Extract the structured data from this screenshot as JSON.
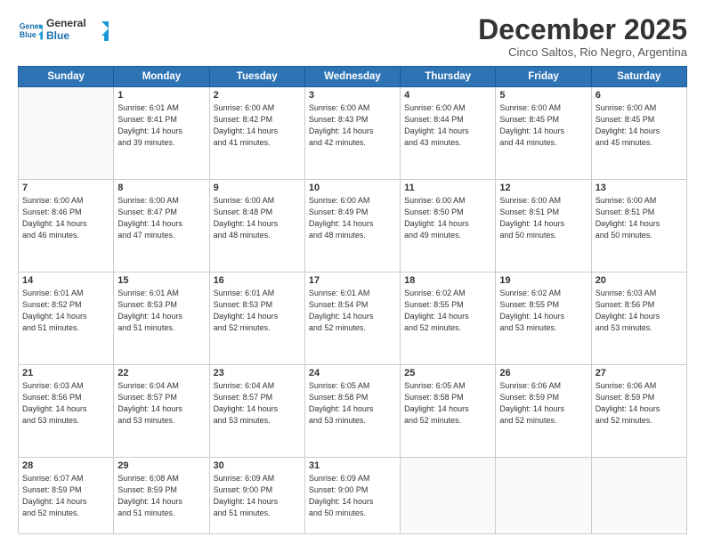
{
  "header": {
    "logo_line1": "General",
    "logo_line2": "Blue",
    "month": "December 2025",
    "location": "Cinco Saltos, Rio Negro, Argentina"
  },
  "weekdays": [
    "Sunday",
    "Monday",
    "Tuesday",
    "Wednesday",
    "Thursday",
    "Friday",
    "Saturday"
  ],
  "weeks": [
    [
      {
        "day": "",
        "info": ""
      },
      {
        "day": "1",
        "info": "Sunrise: 6:01 AM\nSunset: 8:41 PM\nDaylight: 14 hours\nand 39 minutes."
      },
      {
        "day": "2",
        "info": "Sunrise: 6:00 AM\nSunset: 8:42 PM\nDaylight: 14 hours\nand 41 minutes."
      },
      {
        "day": "3",
        "info": "Sunrise: 6:00 AM\nSunset: 8:43 PM\nDaylight: 14 hours\nand 42 minutes."
      },
      {
        "day": "4",
        "info": "Sunrise: 6:00 AM\nSunset: 8:44 PM\nDaylight: 14 hours\nand 43 minutes."
      },
      {
        "day": "5",
        "info": "Sunrise: 6:00 AM\nSunset: 8:45 PM\nDaylight: 14 hours\nand 44 minutes."
      },
      {
        "day": "6",
        "info": "Sunrise: 6:00 AM\nSunset: 8:45 PM\nDaylight: 14 hours\nand 45 minutes."
      }
    ],
    [
      {
        "day": "7",
        "info": "Sunrise: 6:00 AM\nSunset: 8:46 PM\nDaylight: 14 hours\nand 46 minutes."
      },
      {
        "day": "8",
        "info": "Sunrise: 6:00 AM\nSunset: 8:47 PM\nDaylight: 14 hours\nand 47 minutes."
      },
      {
        "day": "9",
        "info": "Sunrise: 6:00 AM\nSunset: 8:48 PM\nDaylight: 14 hours\nand 48 minutes."
      },
      {
        "day": "10",
        "info": "Sunrise: 6:00 AM\nSunset: 8:49 PM\nDaylight: 14 hours\nand 48 minutes."
      },
      {
        "day": "11",
        "info": "Sunrise: 6:00 AM\nSunset: 8:50 PM\nDaylight: 14 hours\nand 49 minutes."
      },
      {
        "day": "12",
        "info": "Sunrise: 6:00 AM\nSunset: 8:51 PM\nDaylight: 14 hours\nand 50 minutes."
      },
      {
        "day": "13",
        "info": "Sunrise: 6:00 AM\nSunset: 8:51 PM\nDaylight: 14 hours\nand 50 minutes."
      }
    ],
    [
      {
        "day": "14",
        "info": "Sunrise: 6:01 AM\nSunset: 8:52 PM\nDaylight: 14 hours\nand 51 minutes."
      },
      {
        "day": "15",
        "info": "Sunrise: 6:01 AM\nSunset: 8:53 PM\nDaylight: 14 hours\nand 51 minutes."
      },
      {
        "day": "16",
        "info": "Sunrise: 6:01 AM\nSunset: 8:53 PM\nDaylight: 14 hours\nand 52 minutes."
      },
      {
        "day": "17",
        "info": "Sunrise: 6:01 AM\nSunset: 8:54 PM\nDaylight: 14 hours\nand 52 minutes."
      },
      {
        "day": "18",
        "info": "Sunrise: 6:02 AM\nSunset: 8:55 PM\nDaylight: 14 hours\nand 52 minutes."
      },
      {
        "day": "19",
        "info": "Sunrise: 6:02 AM\nSunset: 8:55 PM\nDaylight: 14 hours\nand 53 minutes."
      },
      {
        "day": "20",
        "info": "Sunrise: 6:03 AM\nSunset: 8:56 PM\nDaylight: 14 hours\nand 53 minutes."
      }
    ],
    [
      {
        "day": "21",
        "info": "Sunrise: 6:03 AM\nSunset: 8:56 PM\nDaylight: 14 hours\nand 53 minutes."
      },
      {
        "day": "22",
        "info": "Sunrise: 6:04 AM\nSunset: 8:57 PM\nDaylight: 14 hours\nand 53 minutes."
      },
      {
        "day": "23",
        "info": "Sunrise: 6:04 AM\nSunset: 8:57 PM\nDaylight: 14 hours\nand 53 minutes."
      },
      {
        "day": "24",
        "info": "Sunrise: 6:05 AM\nSunset: 8:58 PM\nDaylight: 14 hours\nand 53 minutes."
      },
      {
        "day": "25",
        "info": "Sunrise: 6:05 AM\nSunset: 8:58 PM\nDaylight: 14 hours\nand 52 minutes."
      },
      {
        "day": "26",
        "info": "Sunrise: 6:06 AM\nSunset: 8:59 PM\nDaylight: 14 hours\nand 52 minutes."
      },
      {
        "day": "27",
        "info": "Sunrise: 6:06 AM\nSunset: 8:59 PM\nDaylight: 14 hours\nand 52 minutes."
      }
    ],
    [
      {
        "day": "28",
        "info": "Sunrise: 6:07 AM\nSunset: 8:59 PM\nDaylight: 14 hours\nand 52 minutes."
      },
      {
        "day": "29",
        "info": "Sunrise: 6:08 AM\nSunset: 8:59 PM\nDaylight: 14 hours\nand 51 minutes."
      },
      {
        "day": "30",
        "info": "Sunrise: 6:09 AM\nSunset: 9:00 PM\nDaylight: 14 hours\nand 51 minutes."
      },
      {
        "day": "31",
        "info": "Sunrise: 6:09 AM\nSunset: 9:00 PM\nDaylight: 14 hours\nand 50 minutes."
      },
      {
        "day": "",
        "info": ""
      },
      {
        "day": "",
        "info": ""
      },
      {
        "day": "",
        "info": ""
      }
    ]
  ]
}
